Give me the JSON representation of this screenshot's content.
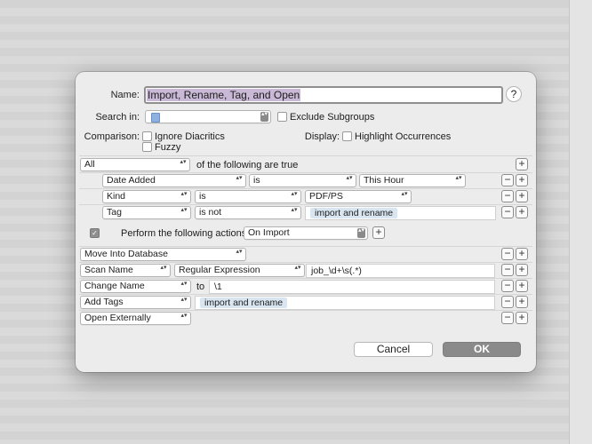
{
  "dialog": {
    "name_label": "Name:",
    "name_value": "Import, Rename, Tag, and Open",
    "help_symbol": "?",
    "search_in_label": "Search in:",
    "exclude_subgroups_label": "Exclude Subgroups",
    "comparison_label": "Comparison:",
    "ignore_diacritics_label": "Ignore Diacritics",
    "fuzzy_label": "Fuzzy",
    "display_label": "Display:",
    "highlight_occurrences_label": "Highlight Occurrences"
  },
  "criteria": {
    "match_mode": "All",
    "match_suffix": "of the following are true",
    "rows": [
      {
        "field": "Date Added",
        "operator": "is",
        "value": "This Hour"
      },
      {
        "field": "Kind",
        "operator": "is",
        "value": "PDF/PS"
      },
      {
        "field": "Tag",
        "operator": "is not",
        "value": "import and rename"
      }
    ]
  },
  "actions": {
    "perform_label": "Perform the following actions:",
    "trigger": "On Import",
    "rows": [
      {
        "action": "Move Into Database"
      },
      {
        "action": "Scan Name",
        "mode": "Regular Expression",
        "value": "job_\\d+\\s(.*)"
      },
      {
        "action": "Change Name",
        "connector": "to",
        "value": "\\1"
      },
      {
        "action": "Add Tags",
        "value": "import and rename"
      },
      {
        "action": "Open Externally"
      }
    ]
  },
  "buttons": {
    "minus": "−",
    "plus": "+",
    "add": "+",
    "cancel": "Cancel",
    "ok": "OK"
  },
  "glyphs": {
    "chevron": "▴▾",
    "check": "✓"
  }
}
